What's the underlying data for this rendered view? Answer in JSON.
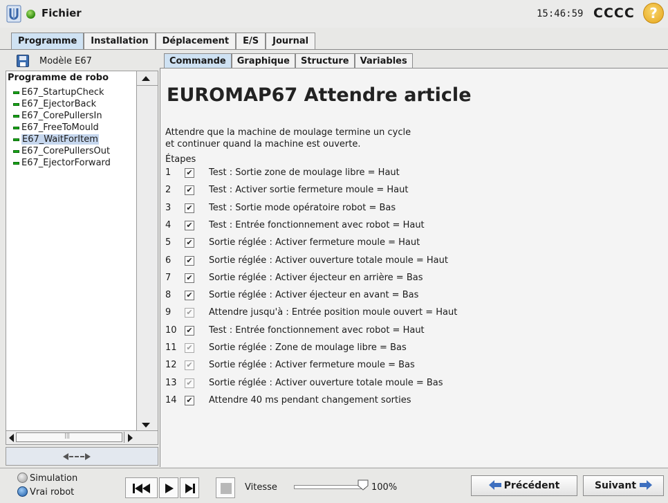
{
  "app": {
    "title": "Fichier",
    "clock": "15:46:59",
    "robot_name": "CCCC",
    "help_label": "?"
  },
  "top_tabs": [
    {
      "label": "Programme",
      "active": true
    },
    {
      "label": "Installation",
      "active": false
    },
    {
      "label": "Déplacement",
      "active": false
    },
    {
      "label": "E/S",
      "active": false
    },
    {
      "label": "Journal",
      "active": false
    }
  ],
  "left_panel": {
    "model_label": "Modèle E67",
    "tree_root": "Programme de robo",
    "items": [
      {
        "label": "E67_StartupCheck",
        "selected": false
      },
      {
        "label": "E67_EjectorBack",
        "selected": false
      },
      {
        "label": "E67_CorePullersIn",
        "selected": false
      },
      {
        "label": "E67_FreeToMould",
        "selected": false
      },
      {
        "label": "E67_WaitForItem",
        "selected": true
      },
      {
        "label": "E67_CorePullersOut",
        "selected": false
      },
      {
        "label": "E67_EjectorForward",
        "selected": false
      }
    ],
    "hscroll_grip": "|||"
  },
  "sub_tabs": [
    {
      "label": "Commande",
      "active": true
    },
    {
      "label": "Graphique",
      "active": false
    },
    {
      "label": "Structure",
      "active": false
    },
    {
      "label": "Variables",
      "active": false
    }
  ],
  "content": {
    "title": "EUROMAP67 Attendre article",
    "description_line1": "Attendre que la machine de moulage termine un cycle",
    "description_line2": "et continuer quand la machine est ouverte.",
    "steps_label": "Étapes",
    "steps": [
      {
        "num": "1",
        "checked": true,
        "enabled": true,
        "label": "Test : Sortie zone de moulage libre = Haut"
      },
      {
        "num": "2",
        "checked": true,
        "enabled": true,
        "label": "Test : Activer sortie fermeture moule = Haut"
      },
      {
        "num": "3",
        "checked": true,
        "enabled": true,
        "label": "Test : Sortie mode opératoire robot = Bas"
      },
      {
        "num": "4",
        "checked": true,
        "enabled": true,
        "label": "Test : Entrée fonctionnement avec robot = Haut"
      },
      {
        "num": "5",
        "checked": true,
        "enabled": true,
        "label": "Sortie réglée : Activer fermeture moule = Haut"
      },
      {
        "num": "6",
        "checked": true,
        "enabled": true,
        "label": "Sortie réglée : Activer ouverture totale moule = Haut"
      },
      {
        "num": "7",
        "checked": true,
        "enabled": true,
        "label": "Sortie réglée : Activer éjecteur en arrière = Bas"
      },
      {
        "num": "8",
        "checked": true,
        "enabled": true,
        "label": "Sortie réglée : Activer éjecteur en avant = Bas"
      },
      {
        "num": "9",
        "checked": true,
        "enabled": false,
        "label": "Attendre jusqu'à : Entrée position moule ouvert = Haut"
      },
      {
        "num": "10",
        "checked": true,
        "enabled": true,
        "label": "Test : Entrée fonctionnement avec robot = Haut"
      },
      {
        "num": "11",
        "checked": true,
        "enabled": false,
        "label": "Sortie réglée : Zone de moulage libre = Bas"
      },
      {
        "num": "12",
        "checked": true,
        "enabled": false,
        "label": "Sortie réglée : Activer fermeture moule = Bas"
      },
      {
        "num": "13",
        "checked": true,
        "enabled": false,
        "label": "Sortie réglée : Activer ouverture totale moule = Bas"
      },
      {
        "num": "14",
        "checked": true,
        "enabled": true,
        "label": "Attendre 40 ms pendant changement sorties"
      }
    ]
  },
  "bottom": {
    "simulation_label": "Simulation",
    "real_robot_label": "Vrai robot",
    "speed_label": "Vitesse",
    "speed_value": "100%",
    "speed_fraction": 1.0,
    "prev_label": "Précédent",
    "next_label": "Suivant"
  },
  "colors": {
    "active_tab": "#cfe2f3",
    "selected_item": "#c6d7ee",
    "status_green": "#2f8a0e",
    "help_yellow": "#e6a51c"
  },
  "icons": [
    "ur-logo-icon",
    "status-dot-icon",
    "help-icon",
    "save-icon",
    "program-node-icon",
    "skip-back-icon",
    "play-icon",
    "step-icon",
    "stop-icon",
    "arrow-left-icon",
    "arrow-right-icon"
  ]
}
